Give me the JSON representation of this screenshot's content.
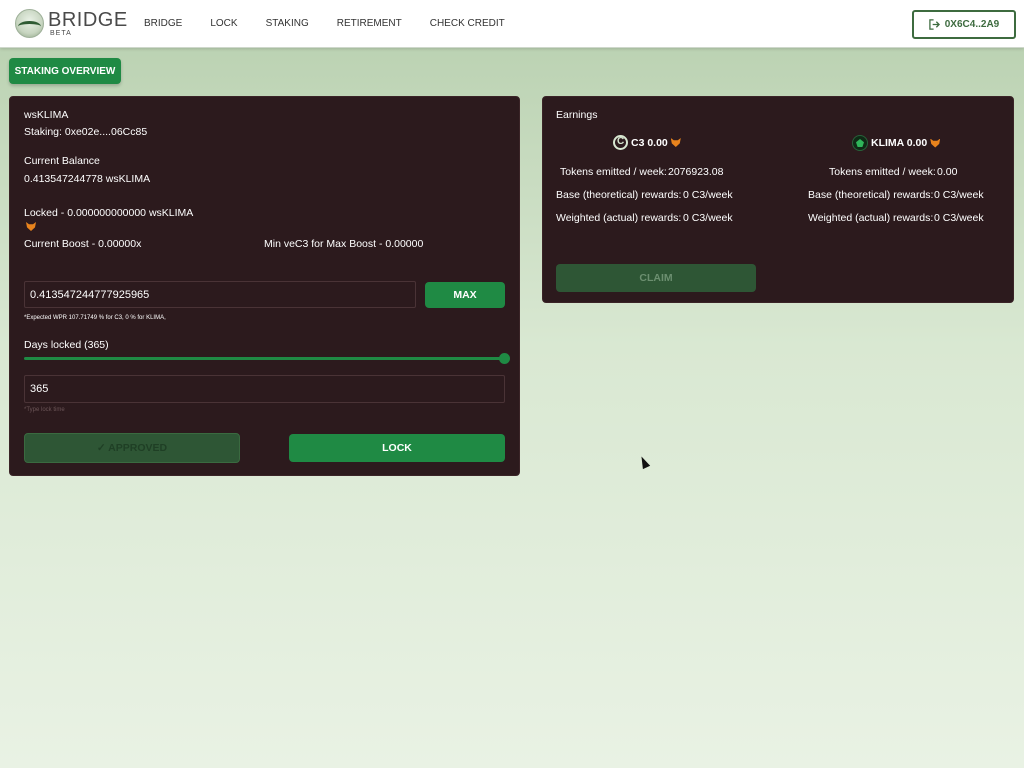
{
  "header": {
    "logo_title": "BRIDGE",
    "logo_sub": "BETA",
    "nav": [
      "BRIDGE",
      "LOCK",
      "STAKING",
      "RETIREMENT",
      "CHECK CREDIT"
    ],
    "wallet": "0X6C4..2A9"
  },
  "overview_label": "STAKING OVERVIEW",
  "left": {
    "token": "wsKLIMA",
    "staking": "Staking: 0xe02e....06Cc85",
    "balance_label": "Current Balance",
    "balance_value": "0.413547244778 wsKLIMA",
    "locked": "Locked - 0.000000000000 wsKLIMA",
    "boost": "Current Boost - 0.00000x",
    "min_vec3": "Min veC3 for Max Boost - 0.00000",
    "amount_value": "0.413547244777925965",
    "max_label": "MAX",
    "wpr_note": "*Expected WPR 107.71749 % for C3, 0 % for KLIMA,",
    "days_label": "Days locked (365)",
    "days_fraction": 1.0,
    "days_value": "365",
    "lock_hint": "*Type lock time",
    "approved_label": "✓ APPROVED",
    "lock_label": "LOCK"
  },
  "right": {
    "title": "Earnings",
    "c3": {
      "header": "C3 0.00",
      "emitted_label": "Tokens emitted / week:",
      "emitted_value": "2076923.08",
      "base_label": "Base (theoretical) rewards:",
      "base_value": "0 C3/week",
      "weighted_label": "Weighted (actual) rewards:",
      "weighted_value": "0 C3/week"
    },
    "klima": {
      "header": "KLIMA 0.00",
      "emitted_label": "Tokens emitted / week:",
      "emitted_value": "0.00",
      "base_label": "Base (theoretical) rewards:",
      "base_value": "0 C3/week",
      "weighted_label": "Weighted (actual) rewards:",
      "weighted_value": "0 C3/week"
    },
    "claim_label": "CLAIM"
  },
  "colors": {
    "accent": "#1f8a44",
    "card_bg": "#2c1a1d"
  },
  "icons": [
    "bridge-logo-icon",
    "logout-icon",
    "metamask-fox-icon",
    "c3-token-icon",
    "klima-token-icon",
    "mouse-cursor-icon"
  ]
}
